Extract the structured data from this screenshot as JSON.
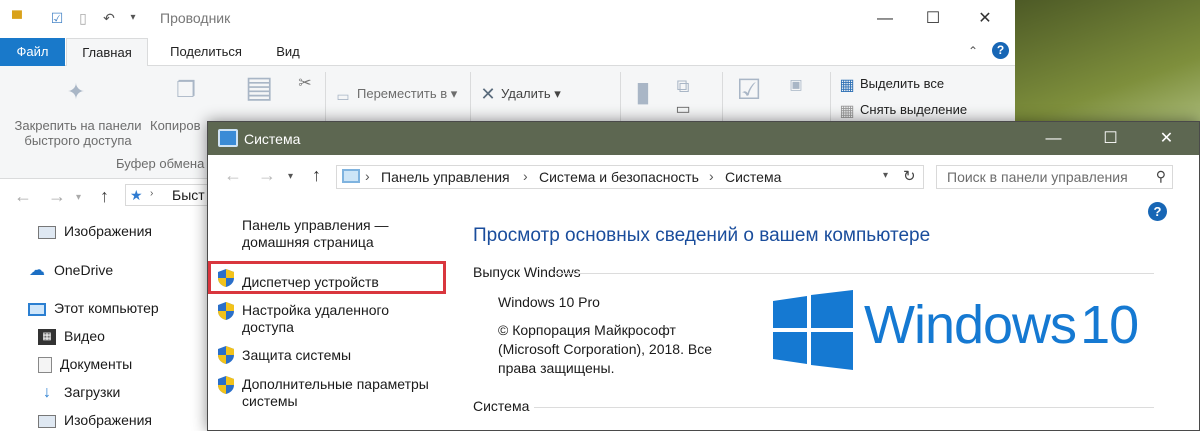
{
  "explorer": {
    "title": "Проводник",
    "tabs": [
      "Файл",
      "Главная",
      "Поделиться",
      "Вид"
    ],
    "ribbon": {
      "pin_label_line1": "Закрепить на панели",
      "pin_label_line2": "быстрого доступа",
      "copy_label": "Копиров",
      "clipboard_group": "Буфер обмена",
      "move_to": "Переместить в",
      "delete": "Удалить",
      "select_all": "Выделить все",
      "deselect": "Снять выделение"
    },
    "address_fragment": "Быст",
    "tree": [
      {
        "label": "Изображения",
        "icon": "pictures-icon"
      },
      {
        "label": "OneDrive",
        "icon": "onedrive-icon"
      },
      {
        "label": "Этот компьютер",
        "icon": "this-pc-icon"
      },
      {
        "label": "Видео",
        "icon": "video-icon"
      },
      {
        "label": "Документы",
        "icon": "documents-icon"
      },
      {
        "label": "Загрузки",
        "icon": "downloads-icon"
      },
      {
        "label": "Изображения",
        "icon": "pictures-icon"
      }
    ]
  },
  "system": {
    "title": "Система",
    "breadcrumbs": [
      "Панель управления",
      "Система и безопасность",
      "Система"
    ],
    "search_placeholder": "Поиск в панели управления",
    "left_pane": {
      "home_line1": "Панель управления —",
      "home_line2": "домашняя страница",
      "device_manager": "Диспетчер устройств",
      "remote_line1": "Настройка удаленного",
      "remote_line2": "доступа",
      "protection": "Защита системы",
      "advanced_line1": "Дополнительные параметры",
      "advanced_line2": "системы"
    },
    "main": {
      "heading": "Просмотр основных сведений о вашем компьютере",
      "edition_section": "Выпуск Windows",
      "edition_name": "Windows 10 Pro",
      "copyright_line1": "© Корпорация Майкрософт",
      "copyright_line2": "(Microsoft Corporation), 2018. Все",
      "copyright_line3": "права защищены.",
      "logo_word": "Windows",
      "logo_number": "10",
      "system_section": "Система"
    }
  },
  "colors": {
    "accent": "#1979ca",
    "system_titlebar": "#5d6751",
    "highlight": "#d9363e",
    "windows_blue": "#1579d2"
  }
}
